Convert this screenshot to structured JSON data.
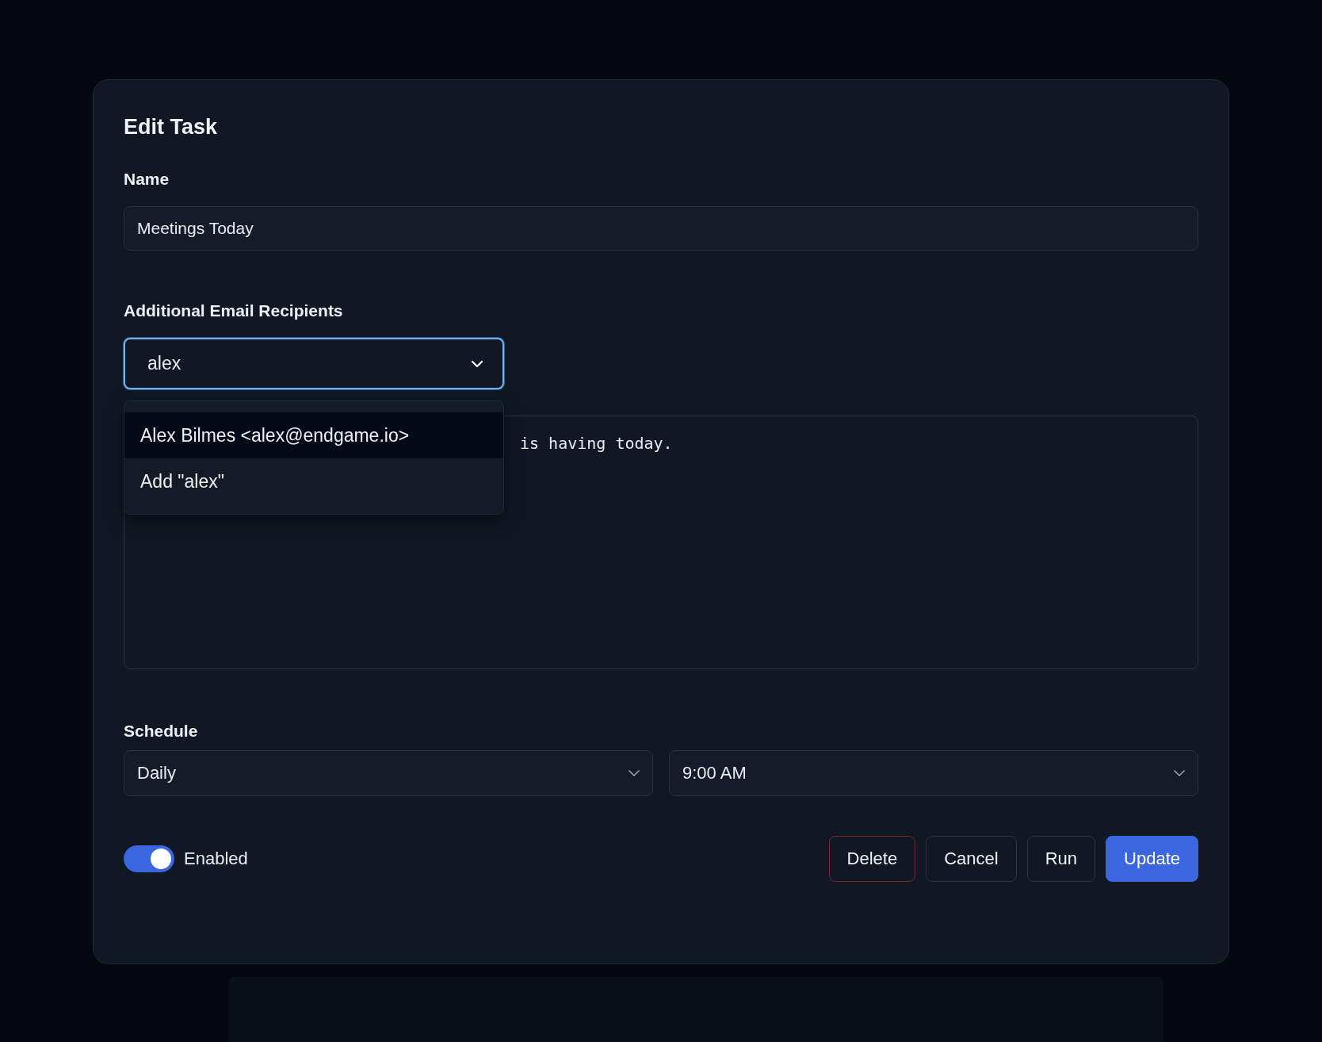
{
  "dialog": {
    "title": "Edit Task",
    "name_field": {
      "label": "Name",
      "value": "Meetings Today"
    },
    "recipients": {
      "label": "Additional Email Recipients",
      "value": "alex",
      "expanded": true,
      "options": [
        {
          "label": "Alex Bilmes <alex@endgame.io>",
          "selected": true
        },
        {
          "label": "Add \"alex\"",
          "selected": false
        }
      ]
    },
    "prompt": {
      "value": "is having today."
    },
    "schedule": {
      "label": "Schedule",
      "frequency": "Daily",
      "time": "9:00 AM"
    },
    "enabled": {
      "label": "Enabled",
      "on": true
    },
    "buttons": [
      {
        "label": "Delete",
        "kind": "danger"
      },
      {
        "label": "Cancel",
        "kind": "secondary"
      },
      {
        "label": "Run",
        "kind": "secondary"
      },
      {
        "label": "Update",
        "kind": "primary"
      }
    ]
  }
}
